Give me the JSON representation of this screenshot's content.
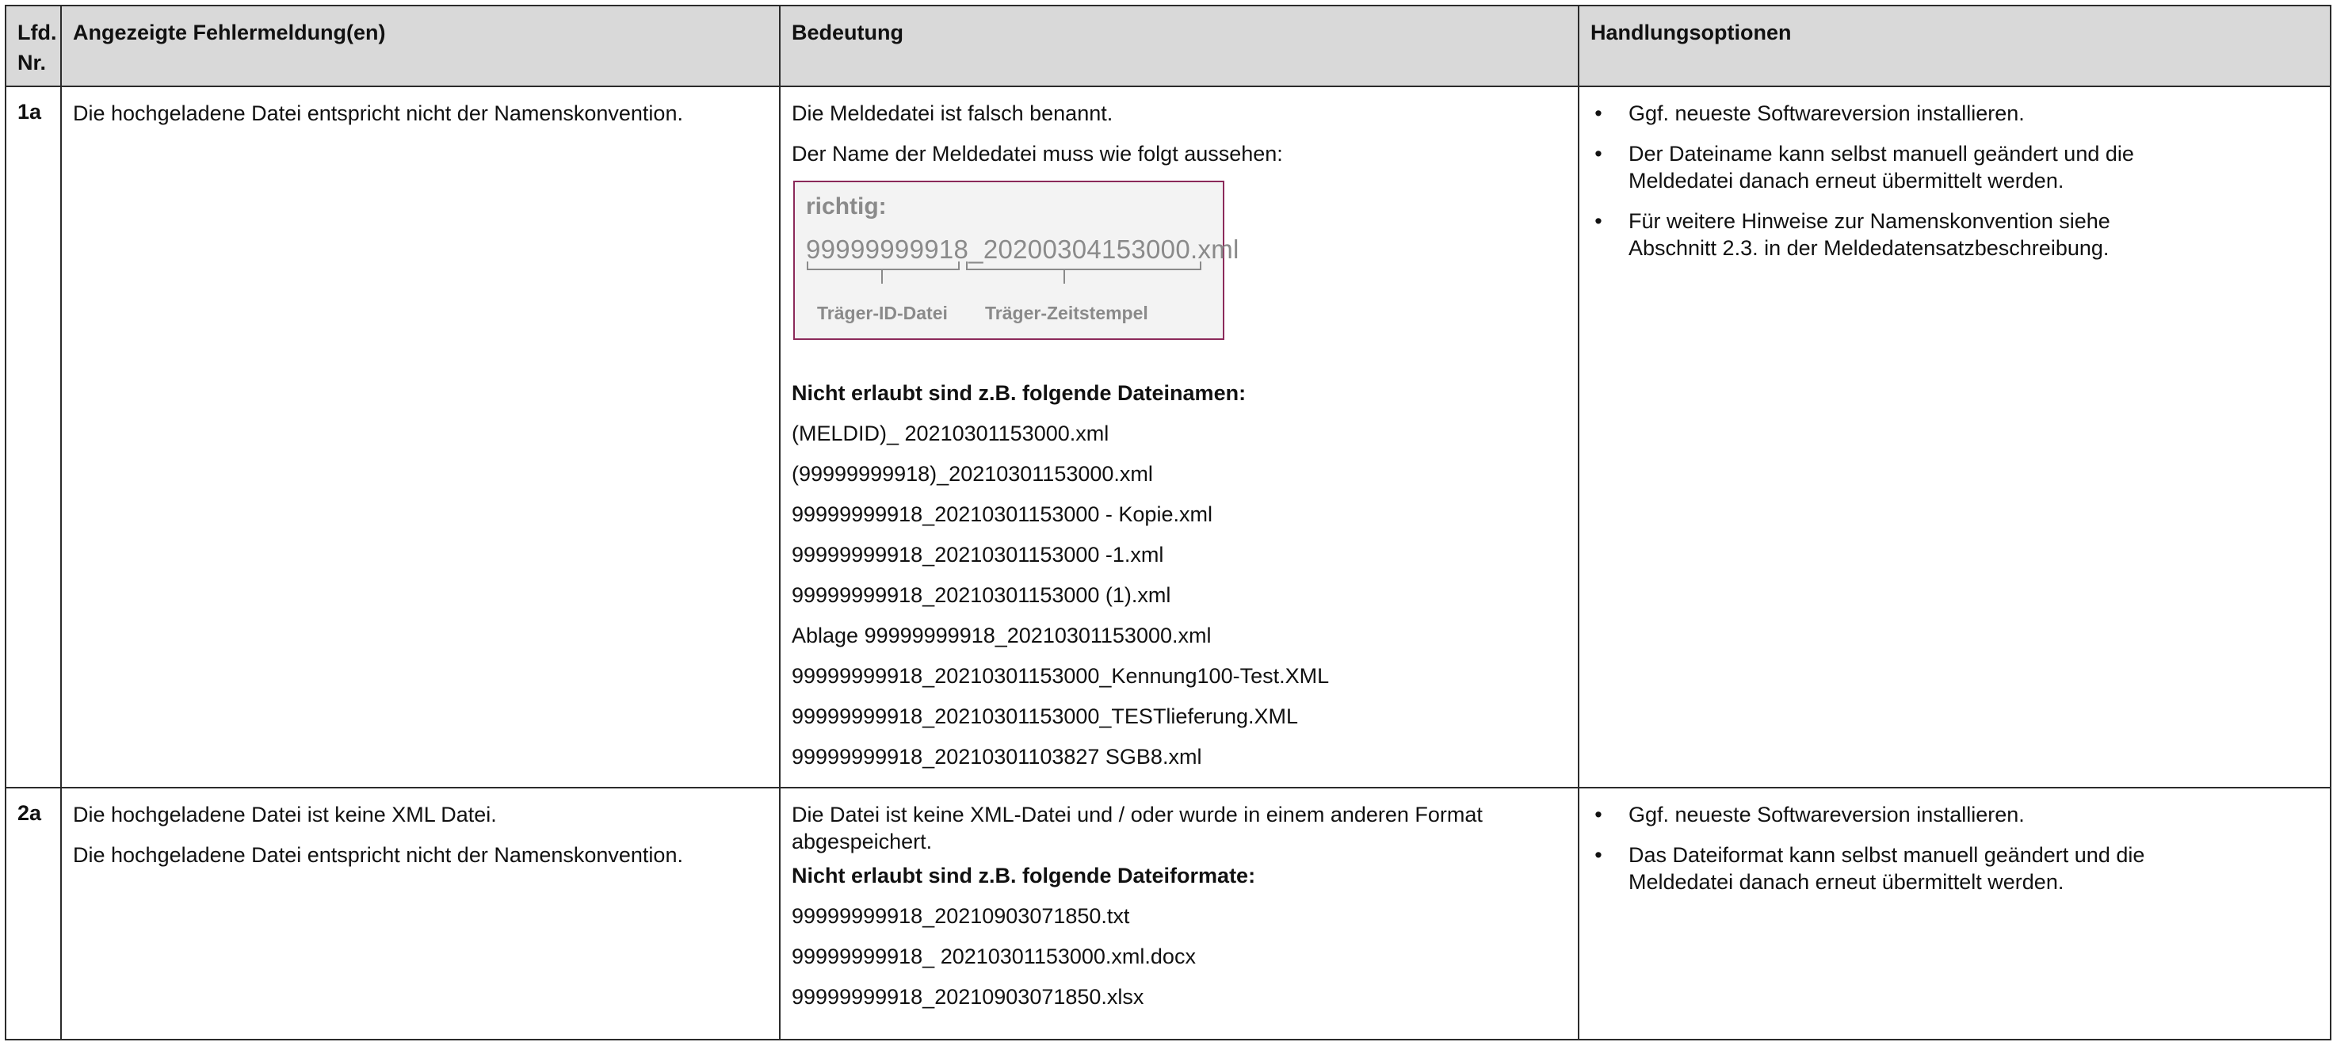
{
  "headers": {
    "nr": "Lfd. Nr.",
    "message": "Angezeigte Fehlermeldung(en)",
    "meaning": "Bedeutung",
    "options": "Handlungsoptionen"
  },
  "rows": [
    {
      "nr": "1a",
      "messages": [
        "Die hochgeladene Datei entspricht nicht der Namenskonvention."
      ],
      "meaning": {
        "intro": [
          "Die Meldedatei ist falsch benannt.",
          "Der Name der Meldedatei muss wie folgt aussehen:"
        ],
        "example": {
          "label": "richtig:",
          "filename": "99999999918_20200304153000.xml",
          "part1_label": "Träger-ID-Datei",
          "part2_label": "Träger-Zeitstempel"
        },
        "not_allowed_heading": "Nicht erlaubt sind z.B. folgende Dateinamen:",
        "not_allowed": [
          "(MELDID)_ 20210301153000.xml",
          "(99999999918)_20210301153000.xml",
          "99999999918_20210301153000 - Kopie.xml",
          "99999999918_20210301153000 -1.xml",
          "99999999918_20210301153000 (1).xml",
          "Ablage 99999999918_20210301153000.xml",
          "99999999918_20210301153000_Kennung100-Test.XML",
          "99999999918_20210301153000_TESTlieferung.XML",
          "99999999918_20210301103827 SGB8.xml"
        ]
      },
      "options": [
        "Ggf. neueste Softwareversion installieren.",
        "Der Dateiname kann selbst manuell geändert und die Meldedatei danach erneut übermittelt werden.",
        "Für weitere Hinweise zur Namenskonvention siehe Abschnitt 2.3. in der Meldedatensatzbeschreibung."
      ]
    },
    {
      "nr": "2a",
      "messages": [
        "Die hochgeladene Datei ist keine XML Datei.",
        "Die hochgeladene Datei entspricht nicht der Namenskonvention."
      ],
      "meaning": {
        "intro": [
          "Die Datei ist keine XML-Datei und / oder wurde in einem anderen Format abgespeichert."
        ],
        "not_allowed_heading": "Nicht erlaubt sind z.B. folgende Dateiformate:",
        "not_allowed": [
          "99999999918_20210903071850.txt",
          "99999999918_ 20210301153000.xml.docx",
          "99999999918_20210903071850.xlsx"
        ]
      },
      "options": [
        "Ggf. neueste Softwareversion installieren.",
        "Das Dateiformat kann selbst manuell geändert und die Meldedatei danach erneut übermittelt werden."
      ]
    }
  ]
}
